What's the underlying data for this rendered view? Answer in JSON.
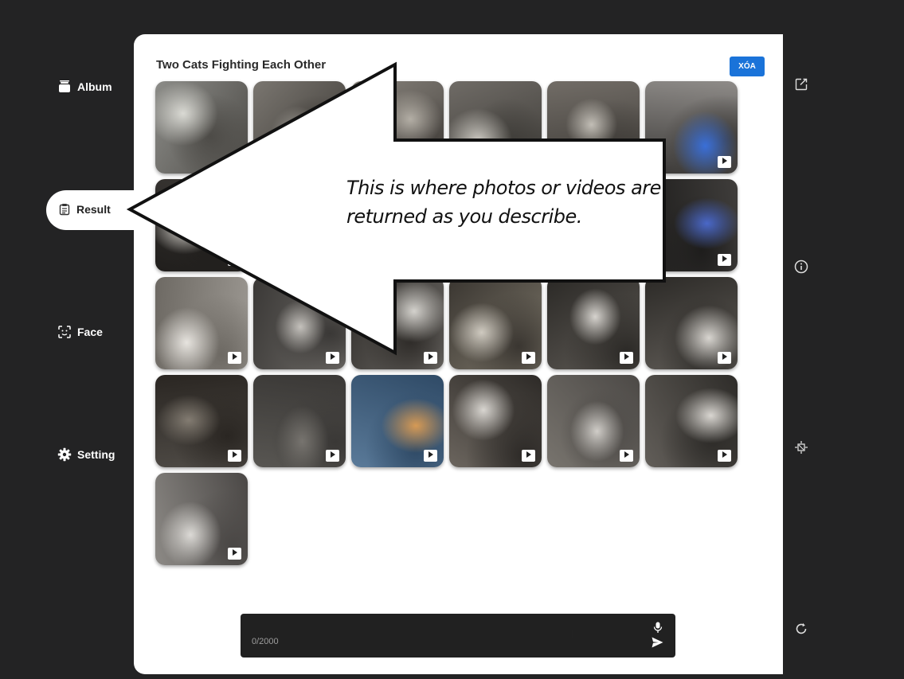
{
  "sidebar": {
    "items": [
      {
        "label": "Album",
        "icon": "album-icon"
      },
      {
        "label": "Result",
        "icon": "clipboard-icon"
      },
      {
        "label": "Face",
        "icon": "face-scan-icon"
      },
      {
        "label": "Setting",
        "icon": "gear-icon"
      }
    ]
  },
  "result": {
    "title": "Two Cats Fighting Each Other",
    "delete_label": "XÓA"
  },
  "thumbnails": [
    {
      "kind": "video",
      "palette": [
        "#8c8c88",
        "#4d4b47",
        "#dadad4"
      ]
    },
    {
      "kind": "video",
      "palette": [
        "#7a7670",
        "#3a3733",
        "#a8a49d"
      ]
    },
    {
      "kind": "video",
      "palette": [
        "#87827b",
        "#46423e",
        "#b3aea5"
      ]
    },
    {
      "kind": "video",
      "palette": [
        "#6f6b66",
        "#3b3935",
        "#c9c6bf"
      ]
    },
    {
      "kind": "video",
      "palette": [
        "#716c66",
        "#3d3a36",
        "#c2beb6"
      ]
    },
    {
      "kind": "video",
      "palette": [
        "#8e8b88",
        "#3c3a38",
        "#3a6fd8"
      ]
    },
    {
      "kind": "video",
      "palette": [
        "#3b3835",
        "#201e1c",
        "#d5d2cc"
      ]
    },
    {
      "kind": "video",
      "palette": [
        "#4d4a47",
        "#292725",
        "#908c86"
      ]
    },
    {
      "kind": "video",
      "palette": [
        "#5b5753",
        "#2e2c2a",
        "#a6a29b"
      ]
    },
    {
      "kind": "video",
      "palette": [
        "#545049",
        "#2a2825",
        "#a7a39c"
      ]
    },
    {
      "kind": "video",
      "palette": [
        "#4e4b48",
        "#282624",
        "#b5b1aa"
      ]
    },
    {
      "kind": "video",
      "palette": [
        "#3f3d3b",
        "#1e1d1c",
        "#4a68c8"
      ]
    },
    {
      "kind": "video",
      "palette": [
        "#9b9791",
        "#6d6963",
        "#e7e4df"
      ]
    },
    {
      "kind": "video",
      "palette": [
        "#6f6c68",
        "#3a3836",
        "#c4c1bc"
      ]
    },
    {
      "kind": "video",
      "palette": [
        "#6c6965",
        "#2e2b28",
        "#d4d2cd"
      ]
    },
    {
      "kind": "video",
      "palette": [
        "#7c7669",
        "#3a3631",
        "#cfcac0"
      ]
    },
    {
      "kind": "video",
      "palette": [
        "#5e5a55",
        "#2b2926",
        "#d6d3ce"
      ]
    },
    {
      "kind": "video",
      "palette": [
        "#605c57",
        "#2c2a27",
        "#d8d5d0"
      ]
    },
    {
      "kind": "video",
      "palette": [
        "#4f4b46",
        "#2a2622",
        "#837c72"
      ]
    },
    {
      "kind": "video",
      "palette": [
        "#585652",
        "#3a3836",
        "#77746f"
      ]
    },
    {
      "kind": "video",
      "palette": [
        "#5a7a99",
        "#2f4a66",
        "#d69a55"
      ]
    },
    {
      "kind": "video",
      "palette": [
        "#6b655e",
        "#2d2a27",
        "#d8d5d0"
      ]
    },
    {
      "kind": "video",
      "palette": [
        "#78746e",
        "#4c4946",
        "#d0cdc8"
      ]
    },
    {
      "kind": "video",
      "palette": [
        "#625e59",
        "#2e2c29",
        "#d9d6d1"
      ]
    },
    {
      "kind": "video",
      "palette": [
        "#8d8a86",
        "#4a4745",
        "#dcdad6"
      ]
    }
  ],
  "input": {
    "char_count": "0/2000"
  },
  "right_toolbar": {
    "icons": [
      "edit-icon",
      "info-icon",
      "focus-icon",
      "refresh-icon"
    ]
  },
  "callout": {
    "text_line1": "This is where photos or videos are",
    "text_line2": "returned as you describe."
  }
}
